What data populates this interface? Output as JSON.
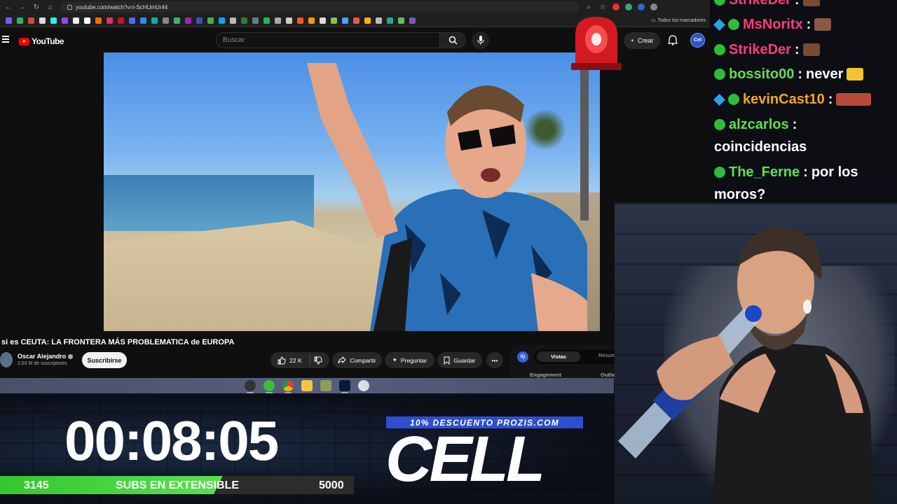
{
  "browser": {
    "url": "youtube.com/watch?v=i-ScHUmUr44",
    "bookmarks_folder": "Todos los marcadores"
  },
  "youtube": {
    "logo_text": "YouTube",
    "search_placeholder": "Buscar",
    "create_label": "Crear",
    "video_title": "si es CEUTA: LA FRONTERA MÁS PROBLEMATICA de EUROPA",
    "channel_name": "Oscar Alejandro",
    "channel_subs": "2,63 M de suscriptores",
    "subscribe_label": "Suscribirse",
    "like_count": "22 K",
    "share_label": "Compartir",
    "ask_label": "Preguntar",
    "save_label": "Guardar",
    "side_panel": {
      "badge": "IQ",
      "tab_active": "Vistas",
      "tab_other": "Resum",
      "label_engagement": "Engagement",
      "label_outlier": "Outlie"
    }
  },
  "chat": {
    "lines": [
      {
        "user": "StrikeDer",
        "sep": " :",
        "user_color": "#ff3b7a"
      },
      {
        "user": "MsNoritx",
        "sep": " :",
        "user_color": "#ff3b7a"
      },
      {
        "user": "StrikeDer",
        "sep": " :",
        "user_color": "#ff3b7a"
      },
      {
        "user": "bossito00",
        "sep": " :",
        "message": "never",
        "user_color": "#5ee04f"
      },
      {
        "user": "kevinCast10",
        "sep": " :",
        "user_color": "#f5a623"
      },
      {
        "user": "alzcarlos",
        "sep": " :",
        "message": "coincidencias",
        "user_color": "#5ee04f"
      },
      {
        "user": "The_Ferne",
        "sep": " :",
        "message": "por los moros?",
        "user_color": "#5ee04f"
      }
    ]
  },
  "overlay": {
    "timer": "00:08:05",
    "subs_current": "3145",
    "subs_label": "SUBS EN EXTENSIBLE",
    "subs_goal": "5000",
    "subs_progress": 0.629,
    "promo_text": "10% DESCUENTO PROZIS.COM",
    "sponsor_text": "CELL"
  },
  "avatar_text": "Cel",
  "colors": {
    "yt_red": "#ff0000",
    "subs_green": "#44d03c",
    "promo_blue": "#2d4fd0"
  }
}
